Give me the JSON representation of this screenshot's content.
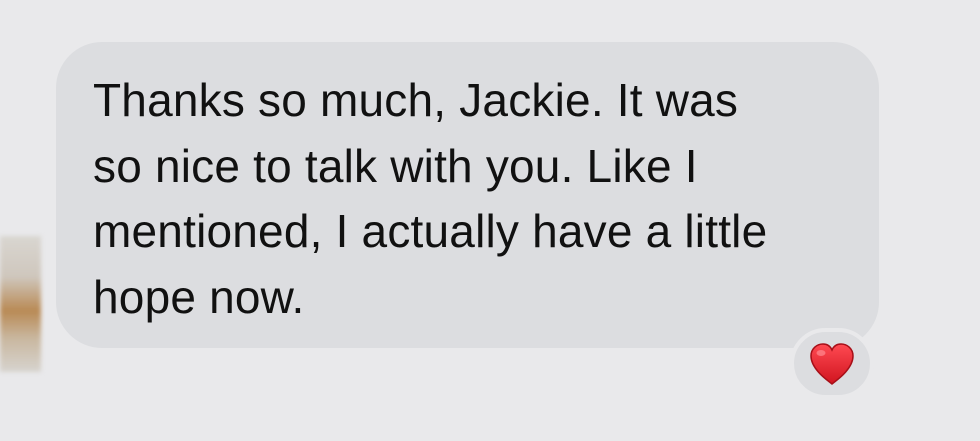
{
  "conversation": {
    "incoming_message": {
      "lines": [
        "Thanks so much, Jackie. It was",
        "so nice to talk with you. Like I",
        "mentioned, I actually have a little",
        "hope now."
      ],
      "reaction_icon": "red-heart-icon"
    }
  },
  "colors": {
    "background": "#e9e9eb",
    "bubble": "#dcdde0",
    "text": "#111111",
    "heart": "#e0212b"
  }
}
